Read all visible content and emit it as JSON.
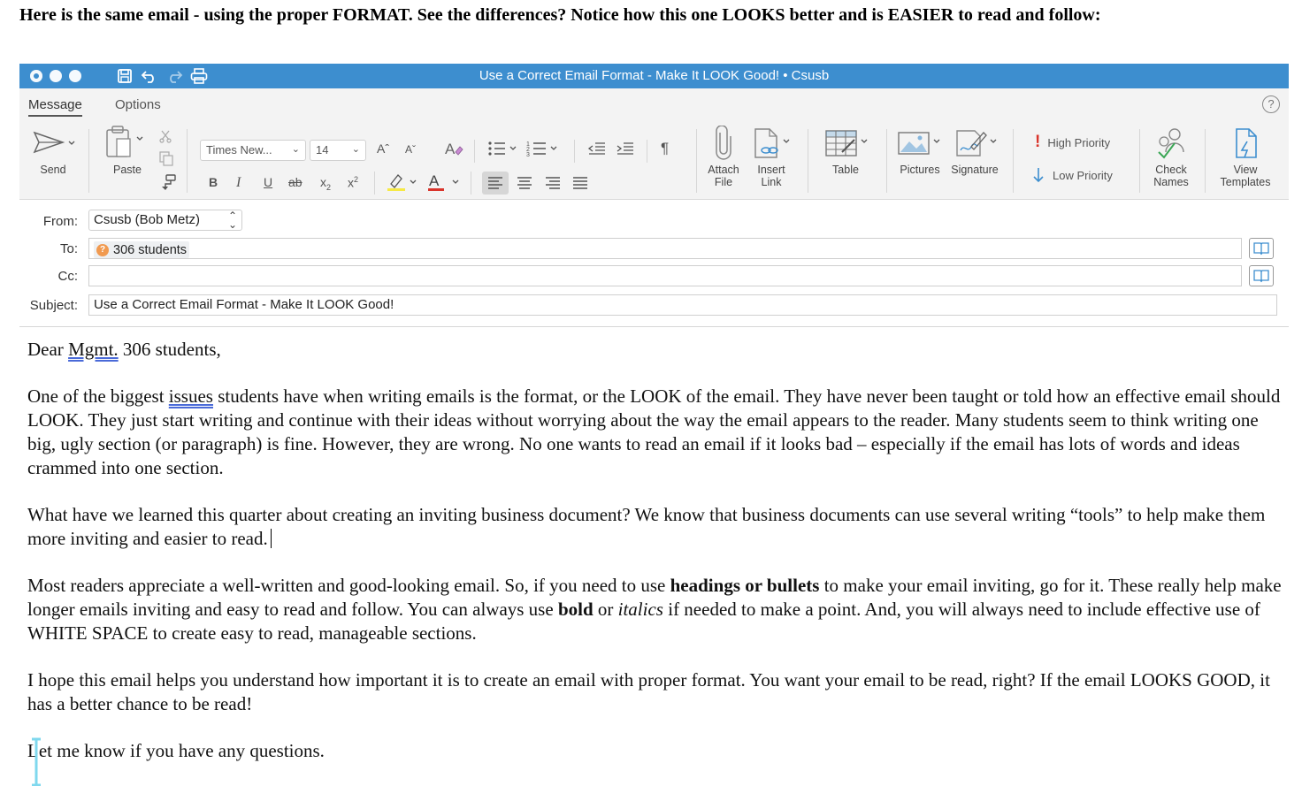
{
  "caption": "Here is the same email - using the proper FORMAT. See the differences? Notice how this one LOOKS better and is EASIER to read and follow:",
  "window": {
    "title": "Use a Correct Email Format - Make It LOOK Good! • Csusb"
  },
  "ribbon_tabs": {
    "message": "Message",
    "options": "Options"
  },
  "ribbon": {
    "send": "Send",
    "paste": "Paste",
    "font_name": "Times New...",
    "font_size": "14",
    "attach_line1": "Attach",
    "attach_line2": "File",
    "insert_line1": "Insert",
    "insert_line2": "Link",
    "table": "Table",
    "pictures": "Pictures",
    "signature": "Signature",
    "high_priority": "High Priority",
    "low_priority": "Low Priority",
    "check_line1": "Check",
    "check_line2": "Names",
    "view_line1": "View",
    "view_line2": "Templates",
    "colors": {
      "accent": "#3d8ecf",
      "high_priority": "#d9342b",
      "low_priority": "#3d8ecf",
      "highlight": "#f6e945",
      "font_color": "#d9342b"
    }
  },
  "headers": {
    "from_label": "From:",
    "from_value": "Csusb (Bob Metz)",
    "to_label": "To:",
    "to_value": "306 students",
    "cc_label": "Cc:",
    "cc_value": "",
    "subject_label": "Subject:",
    "subject_value": "Use a Correct Email Format - Make It LOOK Good!"
  },
  "email_body": {
    "greeting_pre": "Dear ",
    "greeting_mgmt": "Mgmt.",
    "greeting_post": " 306 students,",
    "p1_pre": "One of the biggest ",
    "p1_issues": "issues",
    "p1_post": " students have when writing emails is the format, or the LOOK of the email. They have never been taught or told how an effective email should LOOK. They just start writing and continue with their ideas without worrying about the way the email appears to the reader. Many students seem to think writing one big, ugly section (or paragraph) is fine. However, they are wrong. No one wants to read an email if it looks bad – especially if the email has lots of words and ideas crammed into one section.",
    "p2": "What have we learned this quarter about creating an inviting business document? We know that business documents can use several writing “tools” to help make them more inviting and easier to read.",
    "p3_a": "Most readers appreciate a well-written and good-looking email. So, if you need to use ",
    "p3_bold1": "headings or bullets",
    "p3_b": " to make your email inviting, go for it. These really help make longer emails inviting and easy to read and follow. You can always use ",
    "p3_bold2": "bold",
    "p3_c": " or ",
    "p3_italic": "italics",
    "p3_d": " if needed to make a point. And, you will always need to include effective use of WHITE SPACE to create easy to read, manageable sections.",
    "p4": "I hope this email helps you understand how important it is to create an email with proper format. You want your email to be read, right? If the email LOOKS GOOD, it has a better chance to be read!",
    "p5": "Let me know if you have any questions."
  }
}
